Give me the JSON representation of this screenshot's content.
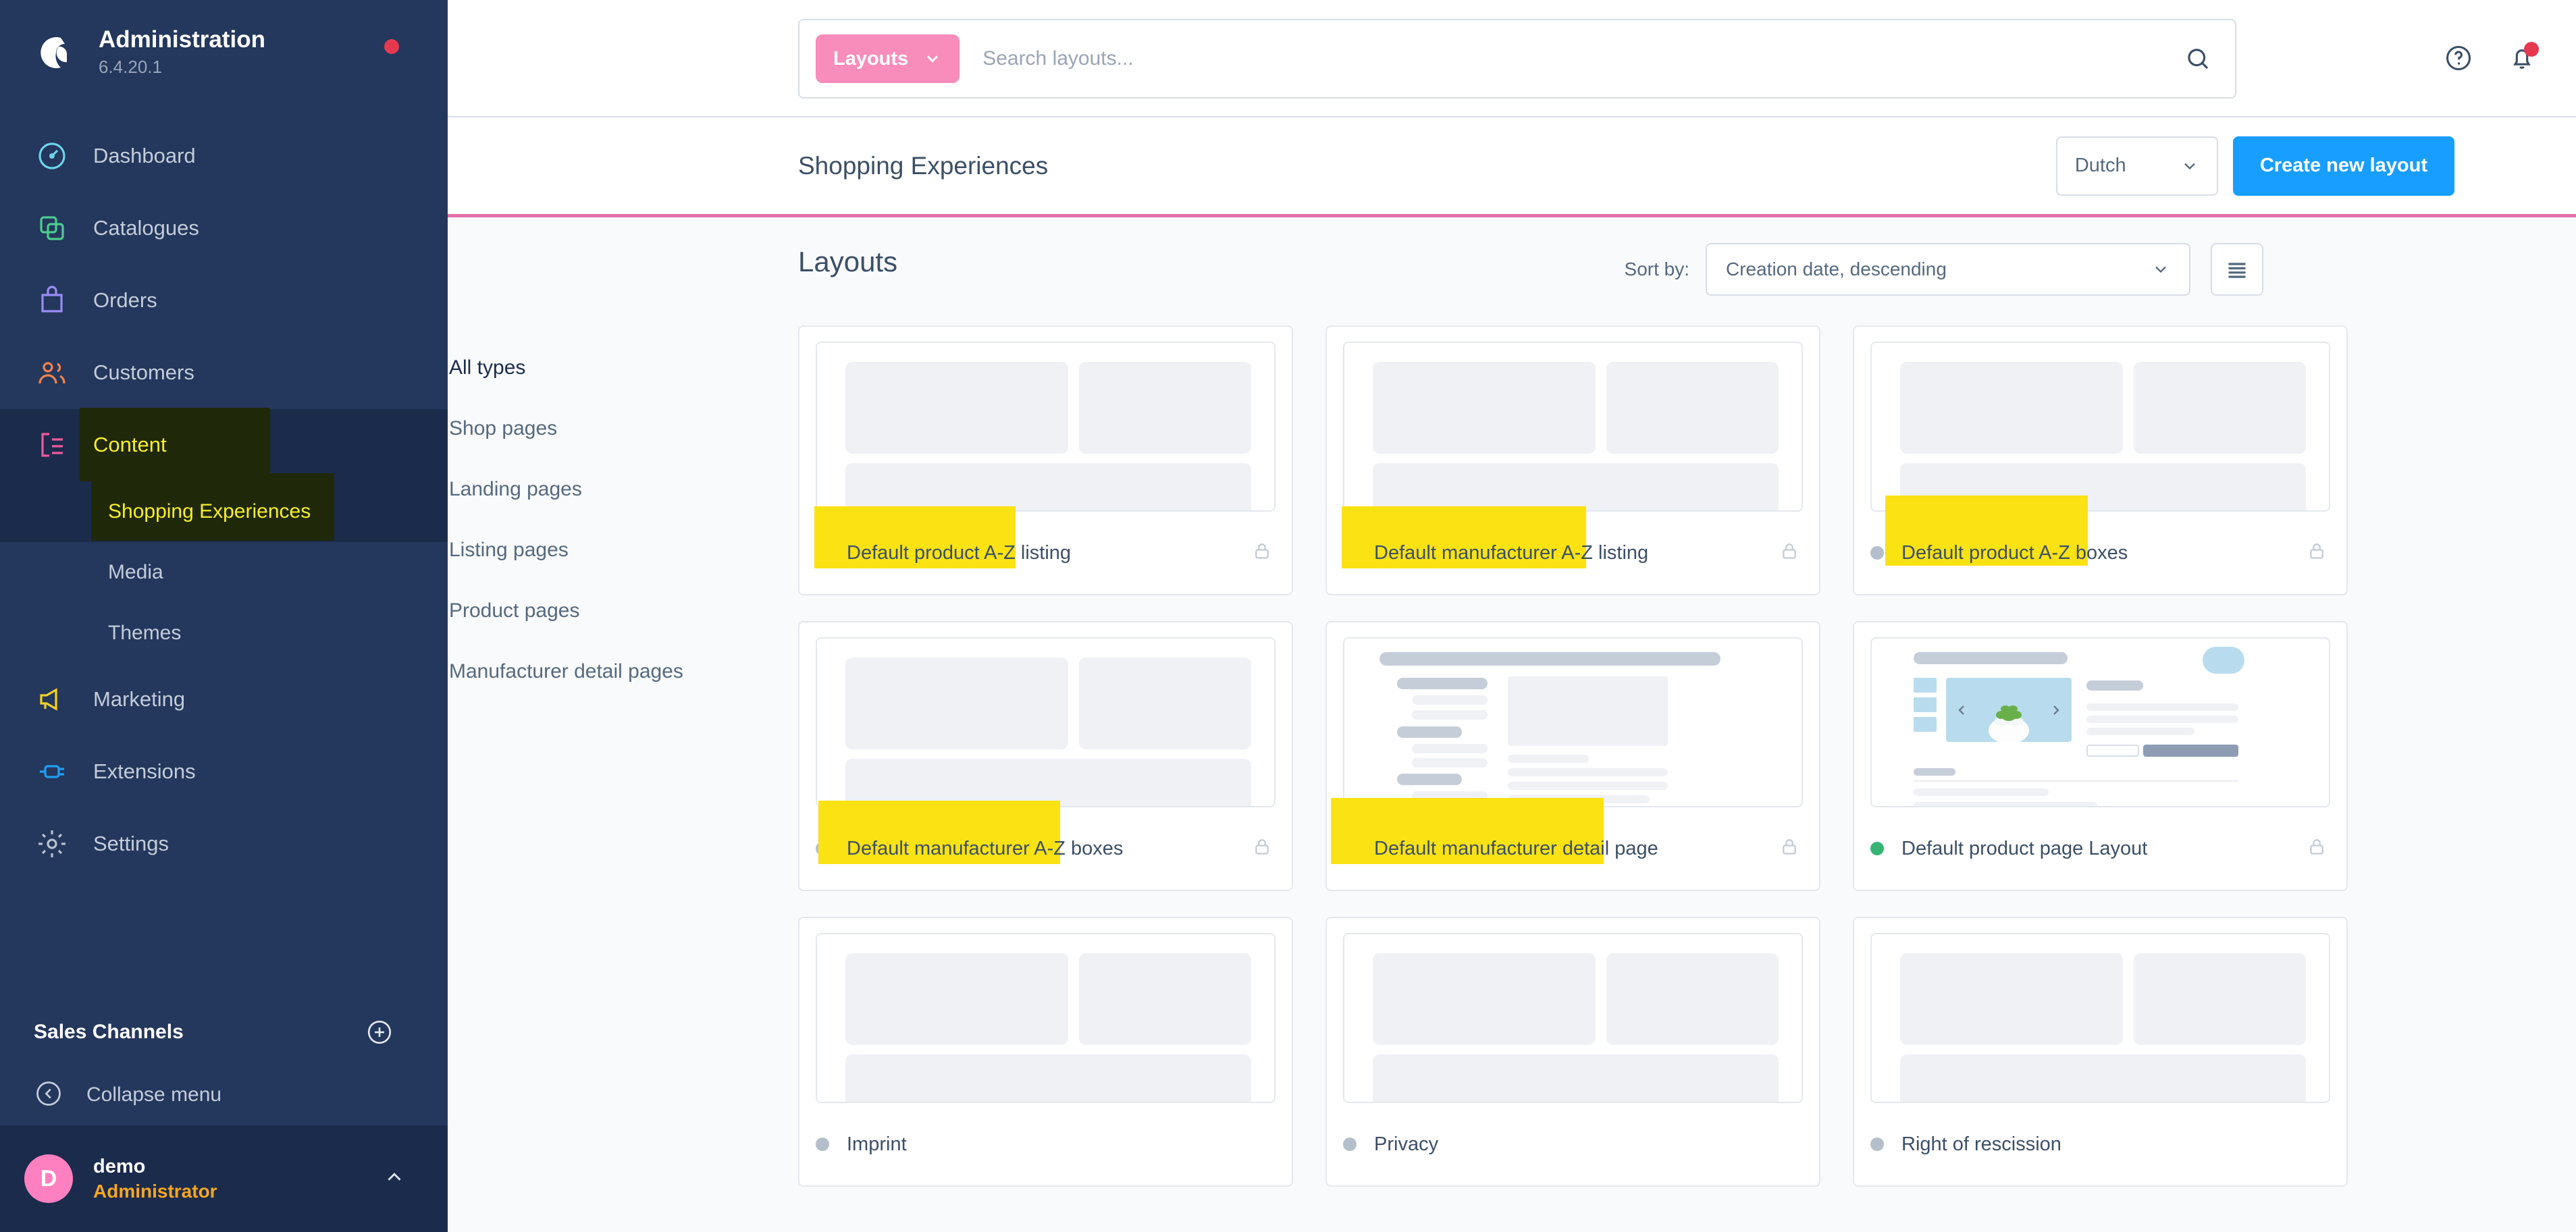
{
  "sidebar": {
    "brand": {
      "title": "Administration",
      "version": "6.4.20.1"
    },
    "items": [
      {
        "label": "Dashboard",
        "icon": "dashboard-icon"
      },
      {
        "label": "Catalogues",
        "icon": "catalogues-icon"
      },
      {
        "label": "Orders",
        "icon": "orders-icon"
      },
      {
        "label": "Customers",
        "icon": "customers-icon"
      },
      {
        "label": "Content",
        "icon": "content-icon"
      },
      {
        "label": "Marketing",
        "icon": "marketing-icon"
      },
      {
        "label": "Extensions",
        "icon": "extensions-icon"
      },
      {
        "label": "Settings",
        "icon": "settings-icon"
      }
    ],
    "content_sub": [
      {
        "label": "Shopping Experiences"
      },
      {
        "label": "Media"
      },
      {
        "label": "Themes"
      }
    ],
    "sales_channels_label": "Sales Channels",
    "add_sales_channel_icon": "plus-circle-icon",
    "collapse_label": "Collapse menu",
    "user": {
      "initial": "D",
      "name": "demo",
      "role": "Administrator"
    }
  },
  "topbar": {
    "search_scope": "Layouts",
    "search_placeholder": "Search layouts...",
    "search_value": "",
    "help_icon": "help-circle-icon",
    "notification_icon": "bell-icon"
  },
  "pagehead": {
    "title": "Shopping Experiences",
    "language": "Dutch",
    "create_button": "Create new layout"
  },
  "section": {
    "title": "Layouts",
    "sort_label": "Sort by:",
    "sort_value": "Creation date, descending",
    "view_toggle_icon": "list-view-icon"
  },
  "filters": [
    {
      "label": "All types",
      "active": true
    },
    {
      "label": "Shop pages",
      "active": false
    },
    {
      "label": "Landing pages",
      "active": false
    },
    {
      "label": "Listing pages",
      "active": false
    },
    {
      "label": "Product pages",
      "active": false
    },
    {
      "label": "Manufacturer detail pages",
      "active": false
    }
  ],
  "layouts": [
    {
      "title": "Default product A-Z listing",
      "status": "on",
      "locked": true,
      "preview": "listing",
      "highlighted": true
    },
    {
      "title": "Default manufacturer A-Z listing",
      "status": "on",
      "locked": true,
      "preview": "listing",
      "highlighted": true
    },
    {
      "title": "Default product A-Z boxes",
      "status": "off",
      "locked": true,
      "preview": "listing",
      "highlighted": true
    },
    {
      "title": "Default manufacturer A-Z boxes",
      "status": "off",
      "locked": true,
      "preview": "listing",
      "highlighted": true
    },
    {
      "title": "Default manufacturer detail page",
      "status": "off",
      "locked": true,
      "preview": "detail",
      "highlighted": true
    },
    {
      "title": "Default product page Layout",
      "status": "on",
      "locked": true,
      "preview": "productpage",
      "highlighted": false
    },
    {
      "title": "Imprint",
      "status": "off",
      "locked": false,
      "preview": "listing",
      "highlighted": false
    },
    {
      "title": "Privacy",
      "status": "off",
      "locked": false,
      "preview": "listing",
      "highlighted": false
    },
    {
      "title": "Right of rescission",
      "status": "off",
      "locked": false,
      "preview": "listing",
      "highlighted": false
    }
  ],
  "colors": {
    "sidebar_bg": "#24375c",
    "sidebar_active": "#1b2b4b",
    "accent_pink": "#f88cbb",
    "pagehead_rule": "#e371a8",
    "primary_button": "#189eff",
    "status_on": "#37b475",
    "status_off": "#b5bfcc",
    "highlight_yellow": "#fbe212",
    "notification_red": "#e63950",
    "avatar_pink": "#ff80c0",
    "role_orange": "#f5a623"
  }
}
